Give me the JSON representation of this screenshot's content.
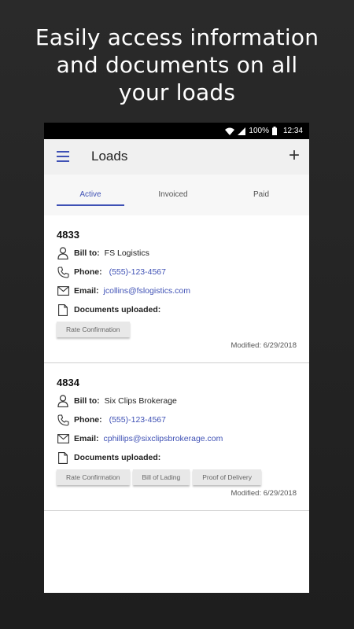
{
  "headline": {
    "line1": "Easily access information",
    "line2": "and documents on all",
    "line3": "your loads"
  },
  "statusbar": {
    "battery": "100%",
    "time": "12:34"
  },
  "appbar": {
    "title": "Loads",
    "add_icon": "plus-icon",
    "menu_icon": "hamburger-icon"
  },
  "tabs": [
    {
      "label": "Active"
    },
    {
      "label": "Invoiced"
    },
    {
      "label": "Paid"
    }
  ],
  "colors": {
    "accent": "#3f51b5"
  },
  "loads": [
    {
      "id": "4833",
      "bill_to_label": "Bill to:",
      "bill_to": "FS Logistics",
      "phone_label": "Phone:",
      "phone": "(555)-123-4567",
      "email_label": "Email:",
      "email": "jcollins@fslogistics.com",
      "docs_label": "Documents uploaded:",
      "documents": [
        "Rate Confirmation"
      ],
      "modified_label": "Modified:",
      "modified": "6/29/2018"
    },
    {
      "id": "4834",
      "bill_to_label": "Bill to:",
      "bill_to": "Six Clips Brokerage",
      "phone_label": "Phone:",
      "phone": "(555)-123-4567",
      "email_label": "Email:",
      "email": "cphillips@sixclipsbrokerage.com",
      "docs_label": "Documents uploaded:",
      "documents": [
        "Rate Confirmation",
        "Bill of Lading",
        "Proof of Delivery"
      ],
      "modified_label": "Modified:",
      "modified": "6/29/2018"
    }
  ]
}
